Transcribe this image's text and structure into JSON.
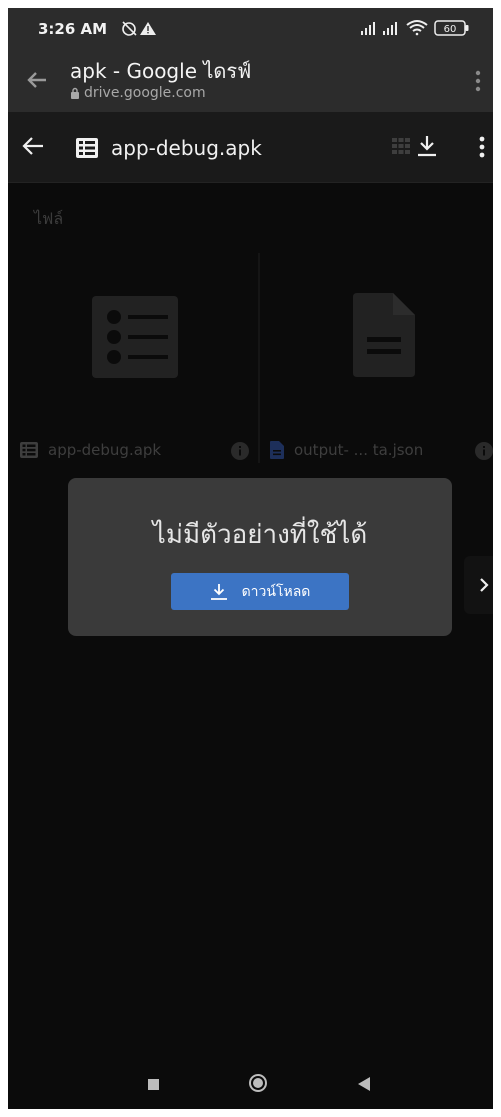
{
  "status_bar": {
    "time": "3:26 AM",
    "left_icons": [
      "alarm-off-icon",
      "warning-icon"
    ],
    "right_icons": [
      "signal-icon",
      "signal-icon",
      "wifi-icon",
      "battery-icon"
    ],
    "battery": "60"
  },
  "browser_bar": {
    "title": "apk - Google ไดรฟ์",
    "url": "drive.google.com"
  },
  "viewer_bar": {
    "file_name": "app-debug.apk"
  },
  "files_section": {
    "label": "ไฟล์",
    "items": [
      {
        "name": "app-debug.apk"
      },
      {
        "name": "output- ... ta.json"
      }
    ]
  },
  "dialog": {
    "message": "ไม่มีตัวอย่างที่ใช้ได้",
    "download_label": "ดาวน์โหลด"
  },
  "colors": {
    "accent": "#3c74c4",
    "bar": "#2c2c2c",
    "background": "#0b0b0b"
  }
}
